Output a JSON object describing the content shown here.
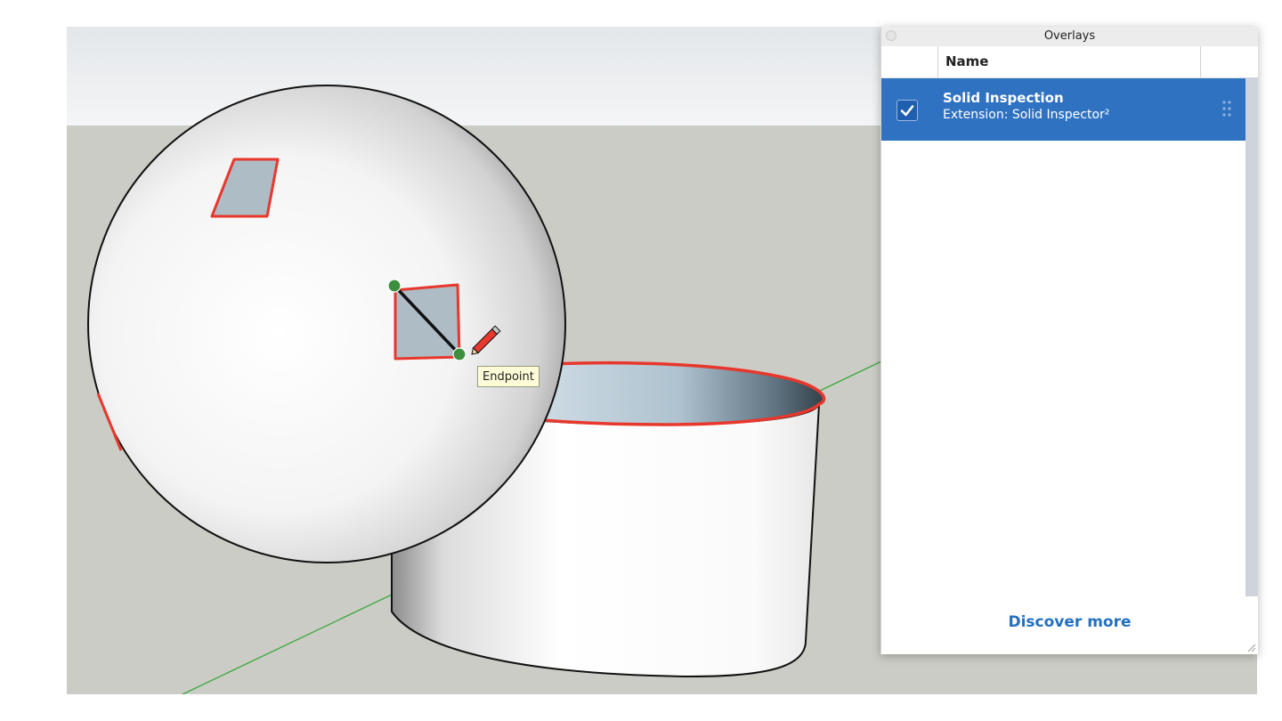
{
  "viewport": {
    "sky_color": "#eceeef",
    "ground_color": "#ccccc6",
    "highlight_color": "#e8372c",
    "axis_color": "#3aa83a",
    "tooltip_text": "Endpoint"
  },
  "overlays_panel": {
    "title": "Overlays",
    "column_header": "Name",
    "items": [
      {
        "title": "Solid Inspection",
        "subtitle": "Extension: Solid Inspector²",
        "checked": true,
        "selected": true
      }
    ],
    "discover_link": "Discover more",
    "accent_color": "#2f72c2"
  }
}
